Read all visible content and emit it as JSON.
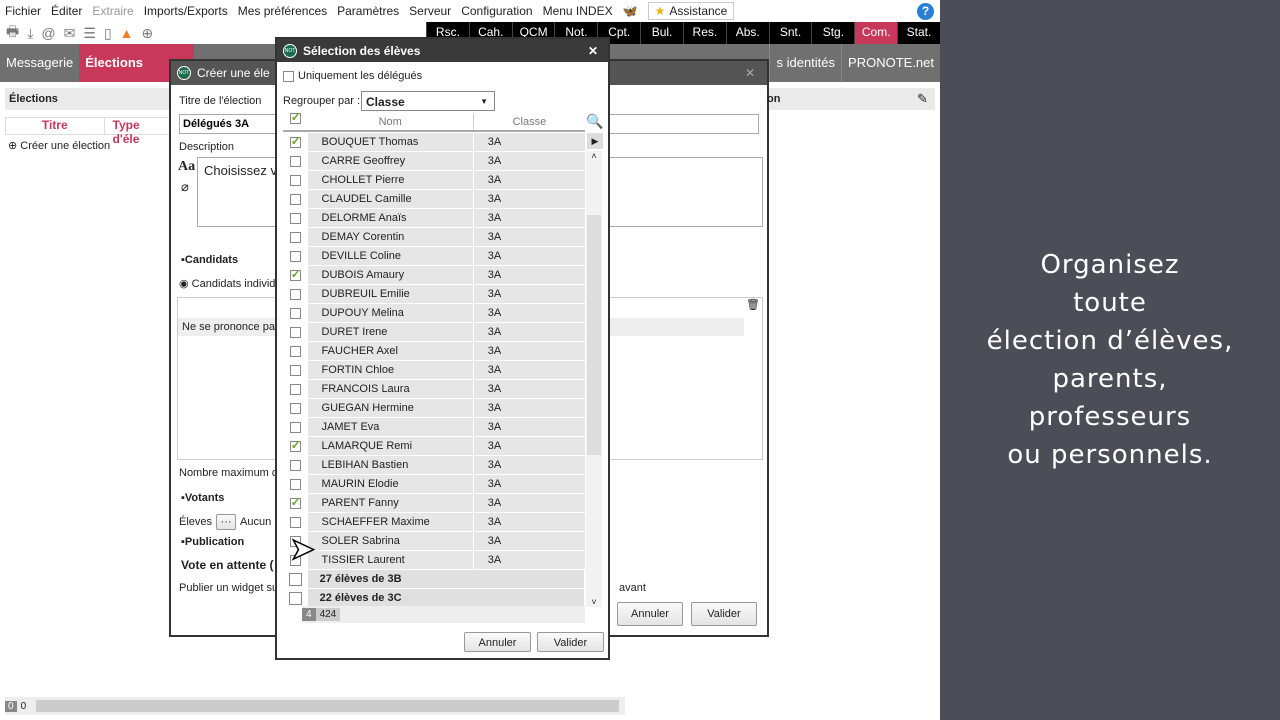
{
  "menu": {
    "items": [
      "Fichier",
      "Éditer",
      "Extraire",
      "Imports/Exports",
      "Mes préférences",
      "Paramètres",
      "Serveur",
      "Configuration",
      "Menu INDEX"
    ],
    "disabled": "Extraire",
    "assistance": "Assistance",
    "help": "?"
  },
  "tabs": [
    {
      "label": "Rsc."
    },
    {
      "label": "Cah."
    },
    {
      "label": "QCM"
    },
    {
      "label": "Not."
    },
    {
      "label": "Cpt."
    },
    {
      "label": "Bul."
    },
    {
      "label": "Res."
    },
    {
      "label": "Abs."
    },
    {
      "label": "Snt."
    },
    {
      "label": "Stg."
    },
    {
      "label": "Com.",
      "active": true
    },
    {
      "label": "Stat."
    }
  ],
  "nav": {
    "messagerie": "Messagerie",
    "elections": "Élections",
    "identites": "s identités",
    "pronote": "PRONOTE.net"
  },
  "left": {
    "header": "Élections",
    "col_titre": "Titre",
    "col_type": "Type d'éle",
    "create": "Créer une élection",
    "footer_a": "0",
    "footer_b": "0"
  },
  "create_dialog": {
    "title": "Créer une éle",
    "titre_label": "Titre de l'élection",
    "titre_value": "Délégués 3A",
    "desc_label": "Description",
    "desc_value": "Choisissez v",
    "candidats": "Candidats",
    "candidats_opt": "Candidats individu",
    "ne_se_prononce": "Ne se prononce pa",
    "nombre_max": "Nombre maximum de",
    "votants": "Votants",
    "eleves": "Éleves",
    "aucun": "Aucun",
    "publication": "Publication",
    "vote_attente": "Vote en attente (",
    "publier": "Publier un widget su",
    "avant": "avant",
    "right_label": "on",
    "annuler": "Annuler",
    "valider": "Valider"
  },
  "select_dialog": {
    "title": "Sélection des élèves",
    "only_delegates": "Uniquement les délégués",
    "group_label": "Regrouper par :",
    "group_value": "Classe",
    "col_nom": "Nom",
    "col_classe": "Classe",
    "students": [
      {
        "nom": "BOUQUET Thomas",
        "classe": "3A",
        "checked": true
      },
      {
        "nom": "CARRE Geoffrey",
        "classe": "3A",
        "checked": false
      },
      {
        "nom": "CHOLLET Pierre",
        "classe": "3A",
        "checked": false
      },
      {
        "nom": "CLAUDEL Camille",
        "classe": "3A",
        "checked": false
      },
      {
        "nom": "DELORME Anaïs",
        "classe": "3A",
        "checked": false
      },
      {
        "nom": "DEMAY Corentin",
        "classe": "3A",
        "checked": false
      },
      {
        "nom": "DEVILLE Coline",
        "classe": "3A",
        "checked": false
      },
      {
        "nom": "DUBOIS Amaury",
        "classe": "3A",
        "checked": true
      },
      {
        "nom": "DUBREUIL Emilie",
        "classe": "3A",
        "checked": false
      },
      {
        "nom": "DUPOUY Melina",
        "classe": "3A",
        "checked": false
      },
      {
        "nom": "DURET Irene",
        "classe": "3A",
        "checked": false
      },
      {
        "nom": "FAUCHER Axel",
        "classe": "3A",
        "checked": false
      },
      {
        "nom": "FORTIN Chloe",
        "classe": "3A",
        "checked": false
      },
      {
        "nom": "FRANCOIS Laura",
        "classe": "3A",
        "checked": false
      },
      {
        "nom": "GUEGAN Hermine",
        "classe": "3A",
        "checked": false
      },
      {
        "nom": "JAMET Eva",
        "classe": "3A",
        "checked": false
      },
      {
        "nom": "LAMARQUE Remi",
        "classe": "3A",
        "checked": true
      },
      {
        "nom": "LEBIHAN Bastien",
        "classe": "3A",
        "checked": false
      },
      {
        "nom": "MAURIN Elodie",
        "classe": "3A",
        "checked": false
      },
      {
        "nom": "PARENT Fanny",
        "classe": "3A",
        "checked": true
      },
      {
        "nom": "SCHAEFFER Maxime",
        "classe": "3A",
        "checked": false
      },
      {
        "nom": "SOLER Sabrina",
        "classe": "3A",
        "checked": false
      },
      {
        "nom": "TISSIER Laurent",
        "classe": "3A",
        "checked": false
      }
    ],
    "groups": [
      "27 élèves de 3B",
      "22 élèves de 3C"
    ],
    "count_selected": "4",
    "count_total": "424",
    "annuler": "Annuler",
    "valider": "Valider"
  },
  "promo": {
    "lines": [
      "Organisez",
      "toute",
      "élection d’élèves,",
      "parents,",
      "professeurs",
      "ou personnels."
    ]
  },
  "colors": {
    "accent": "#c8385a",
    "panel": "#4b4e57",
    "check": "#6aa82f"
  }
}
